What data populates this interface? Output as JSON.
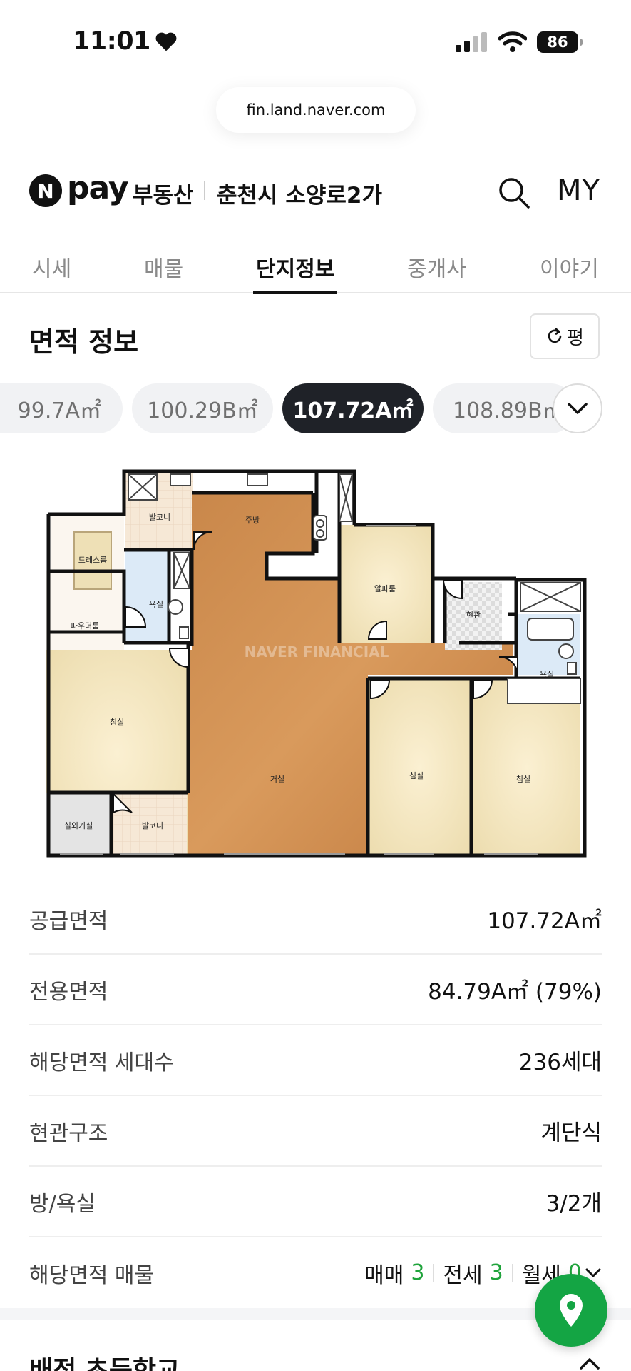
{
  "status": {
    "time": "11:01",
    "battery": "86"
  },
  "browser": {
    "url": "fin.land.naver.com"
  },
  "header": {
    "logo_n": "N",
    "logo_pay": "pay",
    "service": "부동산",
    "title": "춘천시 소양로2가",
    "my_label": "MY"
  },
  "tabs": [
    {
      "label": "시세"
    },
    {
      "label": "매물"
    },
    {
      "label": "단지정보"
    },
    {
      "label": "중개사"
    },
    {
      "label": "이야기"
    }
  ],
  "section": {
    "title": "면적 정보",
    "unit_button": "평"
  },
  "area_chips": [
    {
      "label": "99.7A㎡"
    },
    {
      "label": "100.29B㎡"
    },
    {
      "label": "107.72A㎡"
    },
    {
      "label": "108.89B㎡"
    }
  ],
  "floorplan": {
    "watermark": "NAVER FINANCIAL",
    "rooms": {
      "balcony_top": "발코니",
      "kitchen": "주방",
      "dressroom": "드레스룸",
      "bath1": "욕실",
      "alpha": "알파룸",
      "entrance": "현관",
      "powder": "파우더룸",
      "bath2": "욕실",
      "bed_left": "침실",
      "living": "거실",
      "bed_mid": "침실",
      "bed_right": "침실",
      "outdoor": "실외기실",
      "balcony_bottom": "발코니"
    }
  },
  "info": [
    {
      "label": "공급면적",
      "value": "107.72A㎡"
    },
    {
      "label": "전용면적",
      "value": "84.79A㎡ (79%)"
    },
    {
      "label": "해당면적 세대수",
      "value": "236세대"
    },
    {
      "label": "현관구조",
      "value": "계단식"
    },
    {
      "label": "방/욕실",
      "value": "3/2개"
    }
  ],
  "listings": {
    "label": "해당면적 매물",
    "sale_label": "매매",
    "sale_count": "3",
    "jeonse_label": "전세",
    "jeonse_count": "3",
    "monthly_label": "월세",
    "monthly_count": "0"
  },
  "next_section": {
    "title": "배정 초등학교"
  },
  "colors": {
    "accent_green": "#1fa33b",
    "fab_green": "#14a544",
    "active_chip": "#1f2228"
  }
}
